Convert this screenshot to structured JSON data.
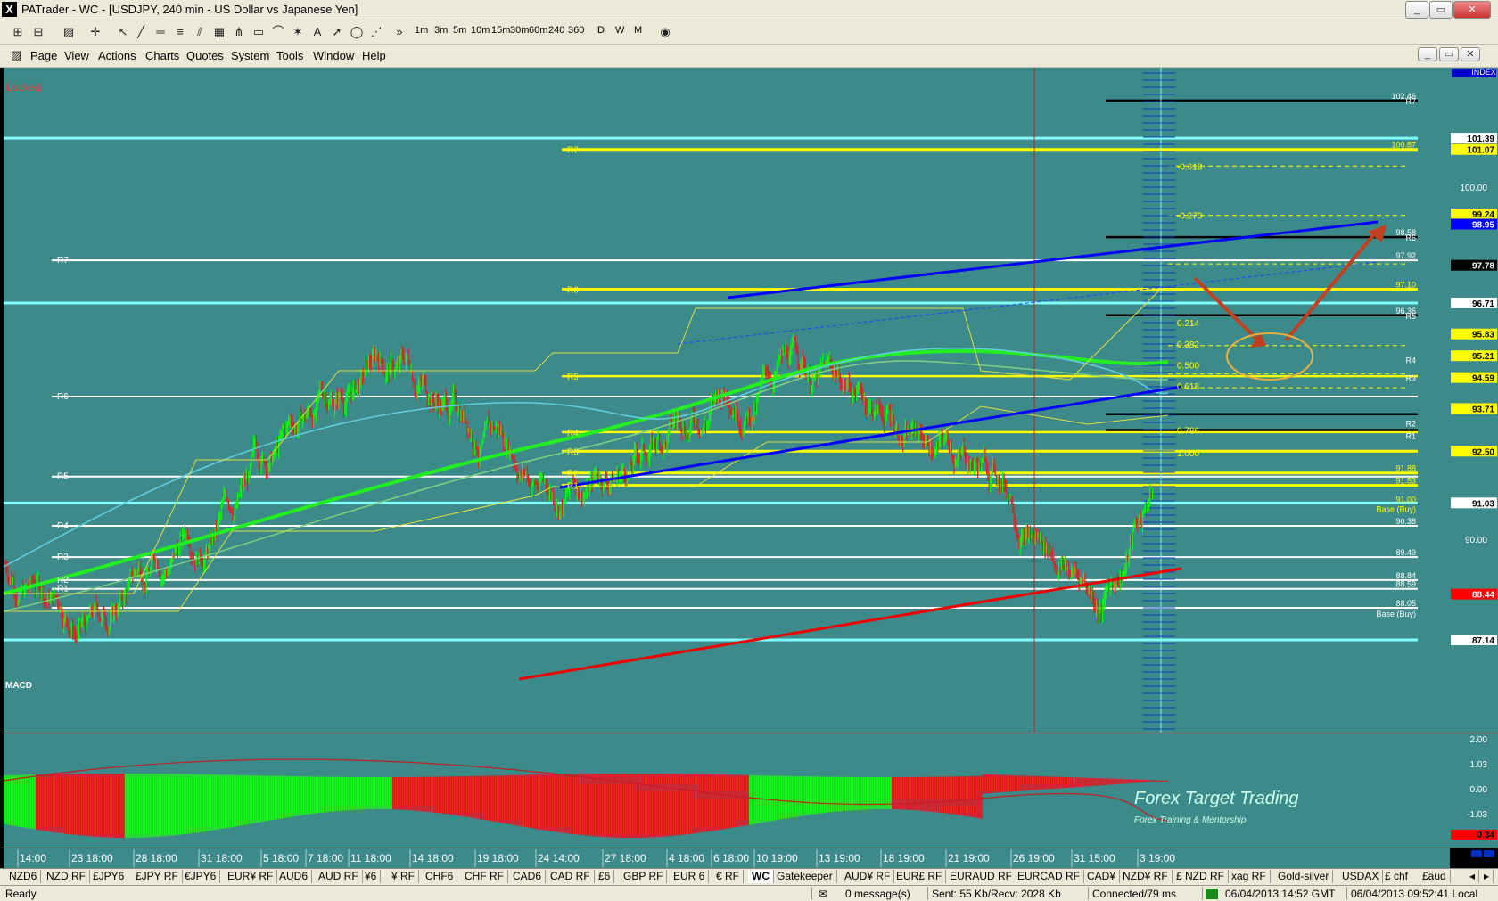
{
  "window": {
    "title": "PATrader - WC - [USDJPY, 240 min - US Dollar vs Japanese Yen]"
  },
  "toolbar": {
    "timeframes": [
      "1m",
      "3m",
      "5m",
      "10m",
      "15m",
      "30m",
      "60m",
      "240",
      "360"
    ],
    "periods": [
      "D",
      "W",
      "M"
    ]
  },
  "menu": {
    "items": [
      "Page",
      "View",
      "Actions",
      "Charts",
      "Quotes",
      "System",
      "Tools",
      "Window",
      "Help"
    ]
  },
  "chart": {
    "locked_label": "Locked",
    "index_label": "INDEX",
    "price_axis": {
      "ticks": [
        "100.00",
        "90.00"
      ],
      "tags": [
        {
          "text": "101.39",
          "color": "#ffffff"
        },
        {
          "text": "101.07",
          "color": "#ffff00"
        },
        {
          "text": "99.24",
          "color": "#ffff00"
        },
        {
          "text": "98.95",
          "color": "#0000ff"
        },
        {
          "text": "97.78",
          "color": "#000000"
        },
        {
          "text": "96.71",
          "color": "#ffffff"
        },
        {
          "text": "95.83",
          "color": "#ffff00"
        },
        {
          "text": "95.21",
          "color": "#ffff00"
        },
        {
          "text": "94.59",
          "color": "#ffff00"
        },
        {
          "text": "93.71",
          "color": "#ffff00"
        },
        {
          "text": "92.50",
          "color": "#ffff00"
        },
        {
          "text": "91.03",
          "color": "#ffffff"
        },
        {
          "text": "88.44",
          "color": "#ff0000"
        },
        {
          "text": "87.14",
          "color": "#ffffff"
        }
      ]
    },
    "pivot_labels_left": [
      "R7",
      "R6",
      "R5",
      "R4",
      "R3",
      "R2",
      "R1"
    ],
    "pivot_labels_mid": [
      "R7",
      "R6",
      "R5",
      "R4",
      "R3",
      "R2",
      "R1"
    ],
    "pivot_labels_right": [
      "R7",
      "R6",
      "R5",
      "R4",
      "R3",
      "R2",
      "R1"
    ],
    "right_values": {
      "black": [
        "102.46",
        "98.58",
        "96.36"
      ],
      "yellow": [
        "100.87",
        "97.10",
        "91.88",
        "91.53",
        "91.00"
      ],
      "white": [
        "97.92",
        "90.38",
        "89.49",
        "88.84",
        "88.59",
        "88.05"
      ],
      "base_buy": "Base (Buy)"
    },
    "fib_labels": [
      "-0.618",
      "-0.270",
      "0.214",
      "0.382",
      "0.500",
      "0.618",
      "0.786",
      "1.000"
    ],
    "time_axis": [
      "14:00",
      "23 18:00",
      "28 18:00",
      "31 18:00",
      "5 18:00",
      "7 18:00",
      "11 18:00",
      "14 18:00",
      "19 18:00",
      "24 14:00",
      "27 18:00",
      "4 18:00",
      "6 18:00",
      "10 19:00",
      "13 19:00",
      "18 19:00",
      "21 19:00",
      "26 19:00",
      "31 15:00",
      "3 19:00"
    ],
    "macd_label": "MACD",
    "macd_ticks": [
      "2.00",
      "1.03",
      "0.00",
      "-1.03"
    ],
    "macd_value": "0.34",
    "watermark": "Forex Target Trading",
    "watermark_sub": "Forex Training & Mentorship",
    "colors": {
      "chart_bg": "#3d8a8a",
      "up": "#00ff00",
      "down": "#e02020",
      "pivot_white": "#ffffff",
      "pivot_yellow": "#ffff00",
      "pivot_cyan": "#80ffff",
      "trend_blue": "#0000ff",
      "trend_red": "#ee0000"
    }
  },
  "tabs": [
    "NZD6",
    "NZD RF",
    "£JPY6",
    "£JPY RF",
    "€JPY6",
    "EUR¥ RF",
    "AUD6",
    "AUD RF",
    "¥6",
    "¥ RF",
    "CHF6",
    "CHF RF",
    "CAD6",
    "CAD RF",
    "£6",
    "GBP RF",
    "EUR 6",
    "€ RF",
    "WC",
    "Gatekeeper",
    "AUD¥ RF",
    "EUR£ RF",
    "EURAUD RF",
    "EURCAD RF",
    "CAD¥",
    "NZD¥ RF",
    "£ NZD RF",
    "xag RF",
    "Gold-silver",
    "USDAX",
    "£ chf",
    "£aud"
  ],
  "active_tab": "WC",
  "status": {
    "ready": "Ready",
    "messages": "0 message(s)",
    "traffic": "Sent: 55 Kb/Recv: 2028 Kb",
    "connection": "Connected/79 ms",
    "gmt_time": "06/04/2013 14:52 GMT",
    "local_time": "06/04/2013 09:52:41 Local"
  }
}
